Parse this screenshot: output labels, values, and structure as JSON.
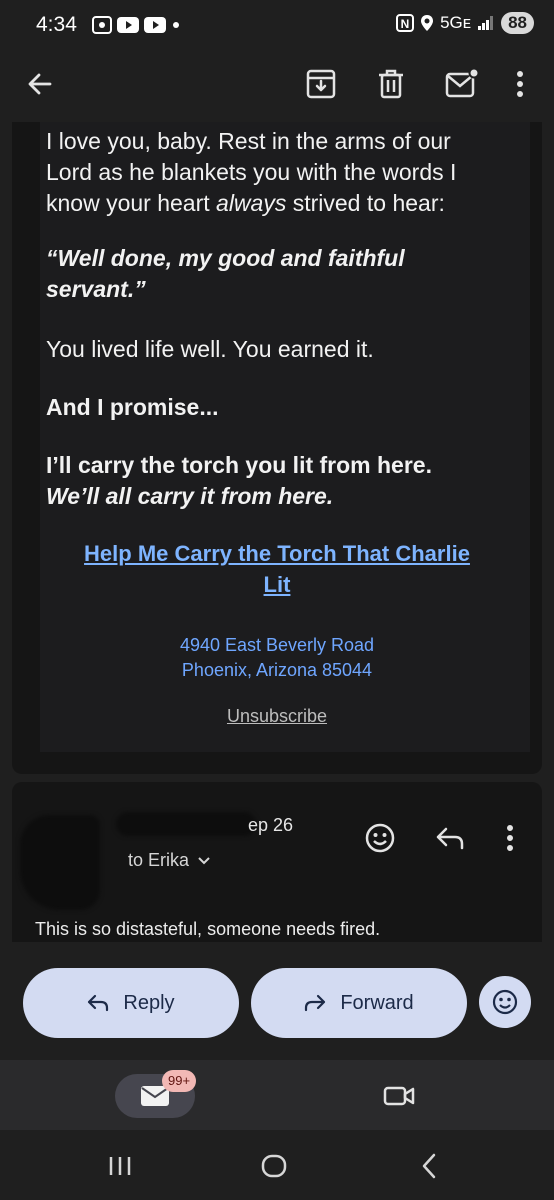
{
  "status_bar": {
    "time": "4:34",
    "network": "5Gᴇ",
    "battery": "88"
  },
  "toolbar": {
    "back_icon": "arrow-left-icon",
    "archive_icon": "archive-icon",
    "delete_icon": "trash-icon",
    "unread_icon": "mark-unread-icon",
    "more_icon": "more-vert-icon"
  },
  "email": {
    "para1_line1": "I love you, baby. Rest in the arms of our",
    "para1_line2": "Lord as he blankets you with the words I",
    "para1_line3_pre": "know your heart ",
    "para1_line3_em": "always",
    "para1_line3_post": " strived to hear:",
    "quote_line1": "“Well done, my good and faithful",
    "quote_line2": "servant.”",
    "para3": "You lived life well. You earned it.",
    "para4": "And I promise...",
    "para5_line1": "I’ll carry the torch you lit from here.",
    "para5_line2": "We’ll all carry it from here.",
    "cta_line1": "Help Me Carry the Torch That Charlie",
    "cta_line2": "Lit",
    "address_line1": "4940 East Beverly Road",
    "address_line2": "Phoenix, Arizona 85044",
    "unsubscribe": "Unsubscribe"
  },
  "reply": {
    "date": "ep 26",
    "to": "to Erika",
    "body": "This is so distasteful, someone needs fired."
  },
  "actions": {
    "reply_label": "Reply",
    "forward_label": "Forward"
  },
  "bottom_nav": {
    "mail_badge": "99+"
  },
  "colors": {
    "background": "#1f1f1f",
    "link": "#7eb4ff",
    "button": "#d3dbf2"
  }
}
